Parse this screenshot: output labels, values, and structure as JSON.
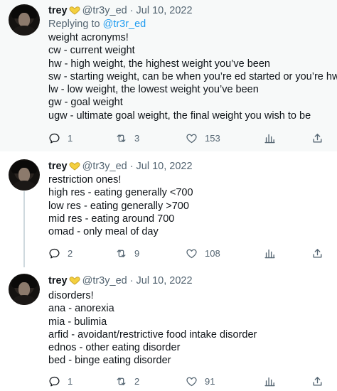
{
  "tweets": [
    {
      "name": "trey",
      "handle": "@tr3y_ed",
      "date": "Jul 10, 2022",
      "replying_prefix": "Replying to",
      "replying_mention": "@tr3r_ed",
      "lines": [
        "weight acronyms!",
        "cw - current weight",
        "hw - high weight, the highest weight you’ve been",
        "sw - starting weight, can be when you’re ed started or you’re hw",
        "lw - low weight, the lowest weight you’ve been",
        "gw - goal weight",
        "ugw - ultimate goal weight, the final weight you wish to be"
      ],
      "replies": "1",
      "retweets": "3",
      "likes": "153"
    },
    {
      "name": "trey",
      "handle": "@tr3y_ed",
      "date": "Jul 10, 2022",
      "lines": [
        "restriction ones!",
        "high res - eating generally <700",
        "low res - eating generally >700",
        "mid res - eating around 700",
        "omad - only meal of day"
      ],
      "replies": "2",
      "retweets": "9",
      "likes": "108"
    },
    {
      "name": "trey",
      "handle": "@tr3y_ed",
      "date": "Jul 10, 2022",
      "lines": [
        "disorders!",
        "ana - anorexia",
        "mia - bulimia",
        "arfid - avoidant/restrictive food intake disorder",
        "ednos - other eating disorder",
        "bed - binge eating disorder"
      ],
      "replies": "1",
      "retweets": "2",
      "likes": "91"
    }
  ],
  "shared": {
    "dot": "·"
  },
  "icons": {
    "badge": "gold-heart-badge-icon",
    "reply": "reply-bubble-icon",
    "retweet": "retweet-icon",
    "like": "heart-icon",
    "views": "views-bar-chart-icon",
    "share": "share-upload-icon"
  },
  "colors": {
    "text": "#0f1419",
    "secondary": "#536471",
    "link": "#1d9bf0",
    "badge": "#e8b923",
    "thread_line": "#cfd9de",
    "highlight_bg": "#f7f9f9"
  }
}
